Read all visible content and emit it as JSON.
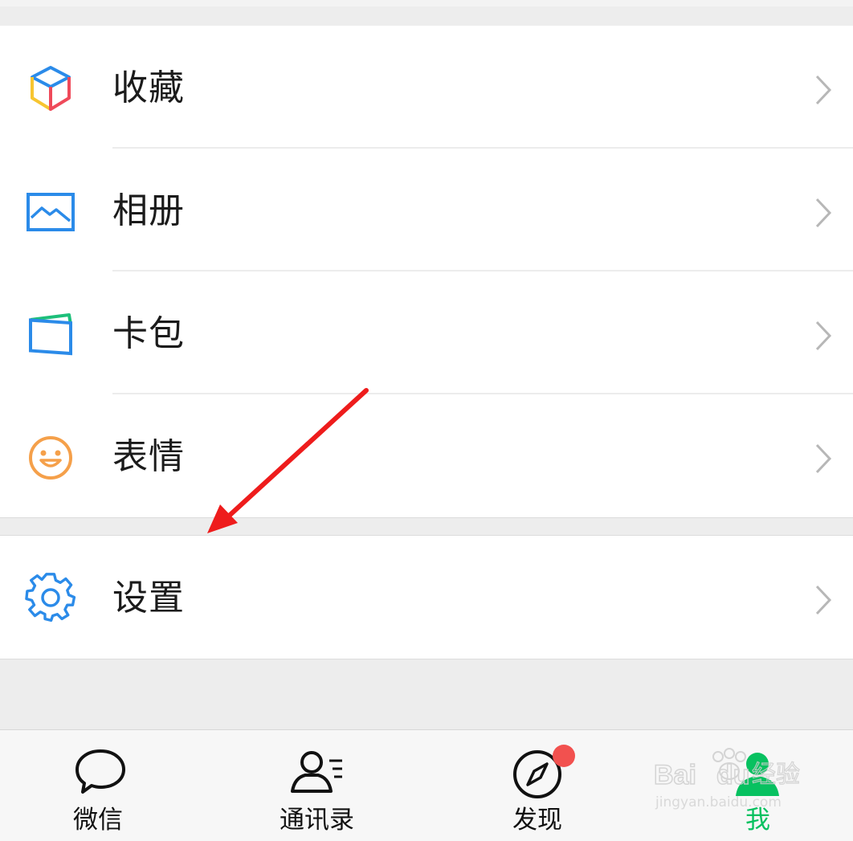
{
  "menu_group_1": [
    {
      "label": "收藏",
      "icon": "favorites-cube-icon"
    },
    {
      "label": "相册",
      "icon": "album-picture-icon"
    },
    {
      "label": "卡包",
      "icon": "card-wallet-icon"
    },
    {
      "label": "表情",
      "icon": "sticker-smile-icon"
    }
  ],
  "menu_group_2": [
    {
      "label": "设置",
      "icon": "gear-icon"
    }
  ],
  "tabbar": {
    "tabs": [
      {
        "label": "微信",
        "icon": "chat-bubble-icon",
        "active": false
      },
      {
        "label": "通讯录",
        "icon": "contacts-icon",
        "active": false
      },
      {
        "label": "发现",
        "icon": "compass-icon",
        "active": false,
        "badge": true
      },
      {
        "label": "我",
        "icon": "me-person-icon",
        "active": true
      }
    ]
  },
  "watermark": {
    "brand": "Bai du 经验",
    "url": "jingyan.baidu.com"
  },
  "colors": {
    "active_green": "#07c160",
    "badge_red": "#f2514f",
    "annotation_arrow": "#ee1c1c",
    "icon_blue": "#1e88e5",
    "sticker_orange": "#f5a04a"
  }
}
